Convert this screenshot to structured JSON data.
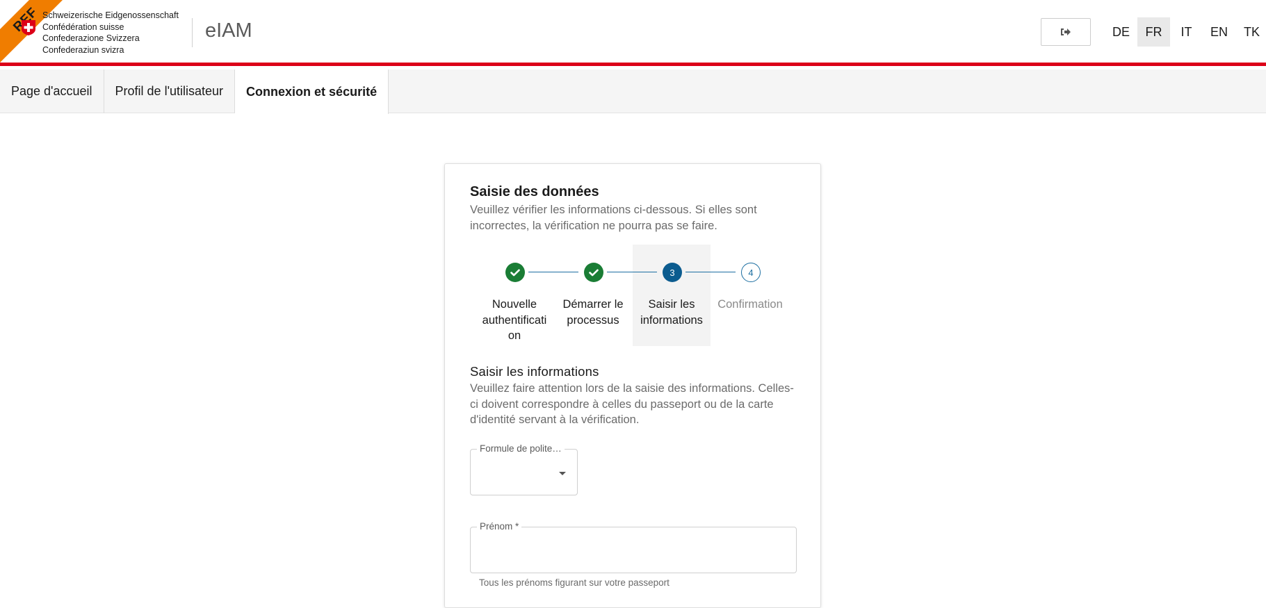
{
  "header": {
    "ribbon": "REF",
    "brand_lines": [
      "Schweizerische Eidgenossenschaft",
      "Confédération suisse",
      "Confederazione Svizzera",
      "Confederaziun svizra"
    ],
    "app_title": "eIAM",
    "logout_icon": "sign-out-icon",
    "languages": [
      {
        "code": "DE",
        "active": false
      },
      {
        "code": "FR",
        "active": true
      },
      {
        "code": "IT",
        "active": false
      },
      {
        "code": "EN",
        "active": false
      },
      {
        "code": "TK",
        "active": false
      }
    ],
    "colors": {
      "red_bar": "#dc0018",
      "ribbon": "#f07d00"
    }
  },
  "nav": {
    "tabs": [
      {
        "label": "Page d'accueil",
        "active": false
      },
      {
        "label": "Profil de l'utilisateur",
        "active": false
      },
      {
        "label": "Connexion et sécurité",
        "active": true
      }
    ]
  },
  "card": {
    "title": "Saisie des données",
    "description": "Veuillez vérifier les informations ci-dessous. Si elles sont incorrectes, la vérification ne pourra pas se faire.",
    "steps": [
      {
        "number": "1",
        "label": "Nouvelle authentificati on",
        "state": "done"
      },
      {
        "number": "2",
        "label": "Démarrer le processus",
        "state": "done"
      },
      {
        "number": "3",
        "label": "Saisir les informations",
        "state": "current"
      },
      {
        "number": "4",
        "label": "Confirmation",
        "state": "todo"
      }
    ],
    "section_title": "Saisir les informations",
    "section_description": "Veuillez faire attention lors de la saisie des informations. Celles-ci doivent correspondre à celles du passeport ou de la carte d'identité servant à la vérification.",
    "salutation": {
      "label": "Formule de polite…",
      "value": ""
    },
    "first_name": {
      "label": "Prénom *",
      "value": "",
      "hint": "Tous les prénoms figurant sur votre passeport"
    },
    "colors": {
      "done": "#1a7d35",
      "current": "#0c5c8f",
      "line": "#1b6ea1"
    }
  }
}
